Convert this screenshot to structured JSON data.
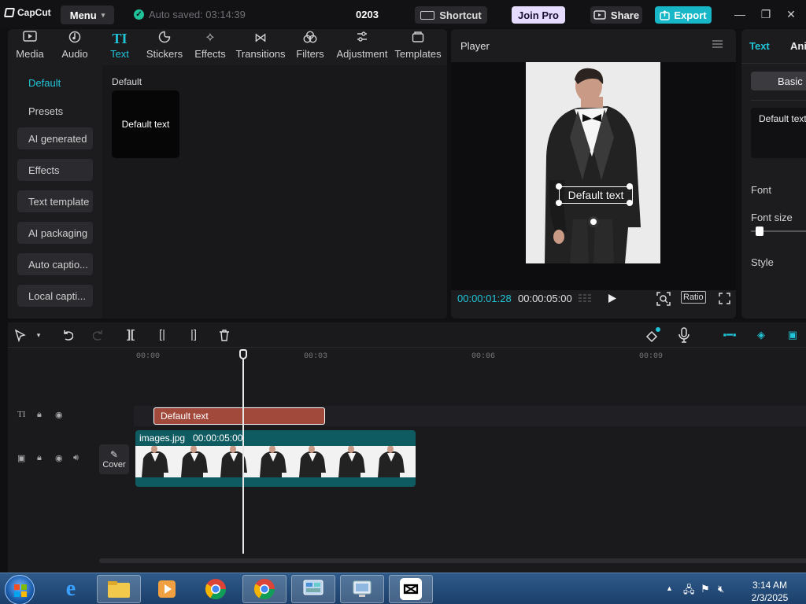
{
  "titlebar": {
    "logo": "CapCut",
    "menu_label": "Menu",
    "autosave": "Auto saved: 03:14:39",
    "project_name": "0203",
    "shortcut_label": "Shortcut",
    "join_pro_label": "Join Pro",
    "share_label": "Share",
    "export_label": "Export"
  },
  "media": {
    "tabs": [
      {
        "label": "Media",
        "icon": "media-icon"
      },
      {
        "label": "Audio",
        "icon": "audio-icon"
      },
      {
        "label": "Text",
        "icon": "text-icon",
        "active": true
      },
      {
        "label": "Stickers",
        "icon": "stickers-icon"
      },
      {
        "label": "Effects",
        "icon": "effects-icon"
      },
      {
        "label": "Transitions",
        "icon": "transitions-icon"
      },
      {
        "label": "Filters",
        "icon": "filters-icon"
      },
      {
        "label": "Adjustment",
        "icon": "adjustment-icon"
      },
      {
        "label": "Templates",
        "icon": "templates-icon"
      }
    ],
    "sidebar": [
      {
        "label": "Default",
        "active": true
      },
      {
        "label": "Presets"
      },
      {
        "label": "AI generated"
      },
      {
        "label": "Effects"
      },
      {
        "label": "Text template"
      },
      {
        "label": "AI packaging"
      },
      {
        "label": "Auto captio..."
      },
      {
        "label": "Local capti..."
      }
    ],
    "section_title": "Default",
    "card_label": "Default text"
  },
  "player": {
    "title": "Player",
    "overlay_text": "Default text",
    "current_time": "00:00:01:28",
    "total_time": "00:00:05:00",
    "ratio_label": "Ratio"
  },
  "props": {
    "tab_text": "Text",
    "tab_animation": "Ani",
    "basic_label": "Basic",
    "text_value": "Default text",
    "font_label": "Font",
    "font_size_label": "Font size",
    "style_label": "Style"
  },
  "timeline": {
    "ruler": [
      "00:00",
      "00:03",
      "00:06",
      "00:09"
    ],
    "text_clip_label": "Default text",
    "video_clip_name": "images.jpg",
    "video_clip_duration": "00:00:05:00",
    "cover_label": "Cover"
  },
  "taskbar": {
    "time": "3:14 AM",
    "date": "2/3/2025"
  },
  "colors": {
    "accent": "#21c4d6",
    "export": "#17b7c7",
    "join_pro": "#e6dcff",
    "text_clip": "#a14a3c",
    "video_clip": "#0f5b62"
  }
}
